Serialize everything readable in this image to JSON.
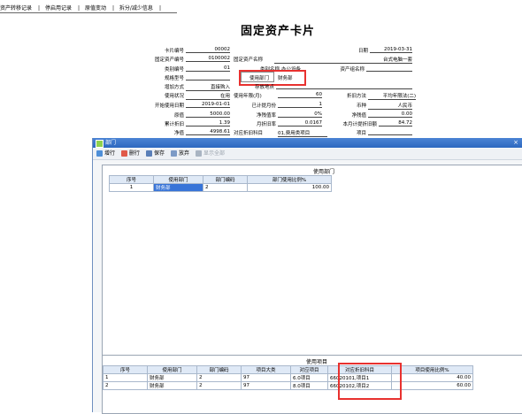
{
  "tabs": [
    {
      "label": "资产转移记录"
    },
    {
      "label": "停启用记录"
    },
    {
      "label": "原值变动"
    },
    {
      "label": "拆分/减少信息"
    }
  ],
  "card": {
    "title": "固定资产卡片",
    "card_no_label": "卡片编号",
    "card_no": "00002",
    "date_label": "日期",
    "date": "2019-03-31",
    "asset_code_label": "固定资产编号",
    "asset_code": "0100002",
    "asset_name_label": "固定资产名称",
    "asset_name": "台式电脑一套",
    "category_code_label": "类别编号",
    "category_code": "01",
    "category_name_label": "类别名称",
    "category_name": "办公设备",
    "asset_group_label": "资产组名称",
    "spec_label": "规格型号",
    "dept_label": "使用部门",
    "dept": "财务部",
    "add_method_label": "增加方式",
    "add_method": "直接购入",
    "location_label": "存放地点",
    "status_label": "使用状况",
    "status": "在用",
    "life_label": "使用年限(月)",
    "life": "60",
    "dep_method_label": "折旧方法",
    "dep_method": "平均年限法(二)",
    "start_date_label": "开始使用日期",
    "start_date": "2019-01-01",
    "months_label": "已计提月份",
    "months": "1",
    "currency_label": "币种",
    "currency": "人民币",
    "orig_label": "原值",
    "orig": "5000.00",
    "salvage_rate_label": "净残值率",
    "salvage_rate": "0%",
    "salvage_label": "净残值",
    "salvage": "0.00",
    "accum_label": "累计折旧",
    "accum": "1.39",
    "monthly_rate_label": "月折旧率",
    "monthly_rate": "0.0167",
    "monthly_amt_label": "本月计提折旧额",
    "monthly_amt": "84.72",
    "net_label": "净值",
    "net": "4998.61",
    "subject_label": "对应折旧科目",
    "subject": "01,费用类项目",
    "project_label": "项目"
  },
  "dialog": {
    "title": "部门",
    "close_label": "×",
    "toolbar": {
      "add": "增行",
      "delete": "删行",
      "save": "保存",
      "cancel": "放弃",
      "show_all": "显示全部"
    },
    "dept_grid": {
      "title": "使用部门",
      "columns": [
        "序号",
        "使用部门",
        "部门编码",
        "部门使用比例%"
      ],
      "rows": [
        {
          "seq": "1",
          "dept": "财务部",
          "code": "2",
          "ratio": "100.00"
        }
      ]
    },
    "project_grid": {
      "title": "使用项目",
      "columns": [
        "序号",
        "使用部门",
        "部门编码",
        "项目大类",
        "对应项目",
        "对应折旧科目",
        "项目使用比例%"
      ],
      "rows": [
        {
          "seq": "1",
          "dept": "财务部",
          "code": "2",
          "class": "97",
          "project": "6.0项目",
          "subject": "66020101,项目1",
          "ratio": "40.00"
        },
        {
          "seq": "2",
          "dept": "财务部",
          "code": "2",
          "class": "97",
          "project": "8.0项目",
          "subject": "66020102,项目2",
          "ratio": "60.00"
        }
      ]
    }
  },
  "colors": {
    "title_bar": "#2d68c0",
    "selection": "#3874d8",
    "highlight": "#e8312f"
  }
}
